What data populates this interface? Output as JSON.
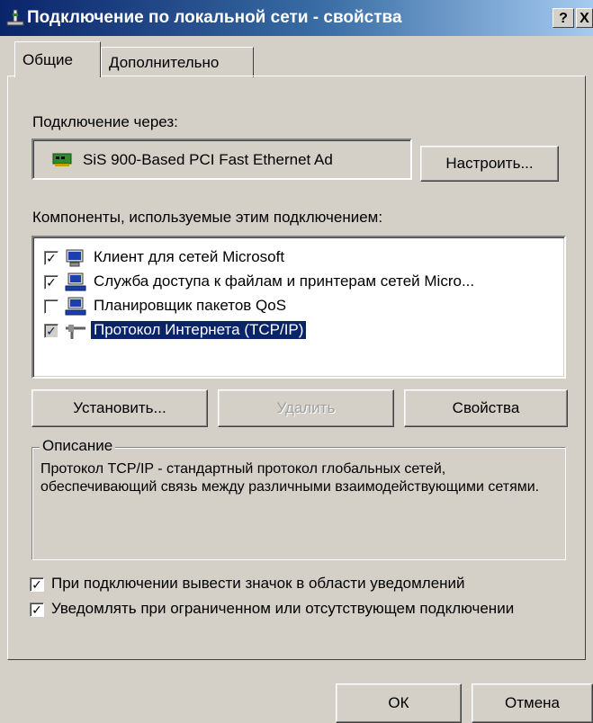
{
  "window": {
    "title": "Подключение по локальной сети - свойства",
    "help_label": "?",
    "close_label": "X"
  },
  "tabs": [
    {
      "label": "Общие",
      "active": true
    },
    {
      "label": "Дополнительно",
      "active": false
    }
  ],
  "connect_via": {
    "label": "Подключение через:",
    "adapter_name": "SiS 900-Based PCI Fast Ethernet Ad",
    "configure_label": "Настроить..."
  },
  "components": {
    "label": "Компоненты, используемые этим подключением:",
    "items": [
      {
        "label": "Клиент для сетей Microsoft",
        "checked": true,
        "icon": "network-client-icon"
      },
      {
        "label": "Служба доступа к файлам и принтерам сетей Micro...",
        "checked": true,
        "icon": "file-printer-service-icon"
      },
      {
        "label": "Планировщик пакетов QoS",
        "checked": false,
        "icon": "qos-scheduler-icon"
      },
      {
        "label": "Протокол Интернета (TCP/IP)",
        "checked": true,
        "selected": true,
        "icon": "network-protocol-icon"
      }
    ]
  },
  "actions": {
    "install_label": "Установить...",
    "remove_label": "Удалить",
    "properties_label": "Свойства"
  },
  "description": {
    "title": "Описание",
    "text": "Протокол TCP/IP - стандартный протокол глобальных сетей, обеспечивающий связь между различными взаимодействующими сетями."
  },
  "options": [
    {
      "label": "При подключении вывести значок в области уведомлений",
      "checked": true
    },
    {
      "label": "Уведомлять при ограниченном или отсутствующем подключении",
      "checked": true
    }
  ],
  "footer": {
    "ok_label": "ОК",
    "cancel_label": "Отмена"
  },
  "colors": {
    "title_start": "#0a246a",
    "title_end": "#a6caf0",
    "dialog_bg": "#d4d0c8",
    "selection": "#0a246a"
  }
}
